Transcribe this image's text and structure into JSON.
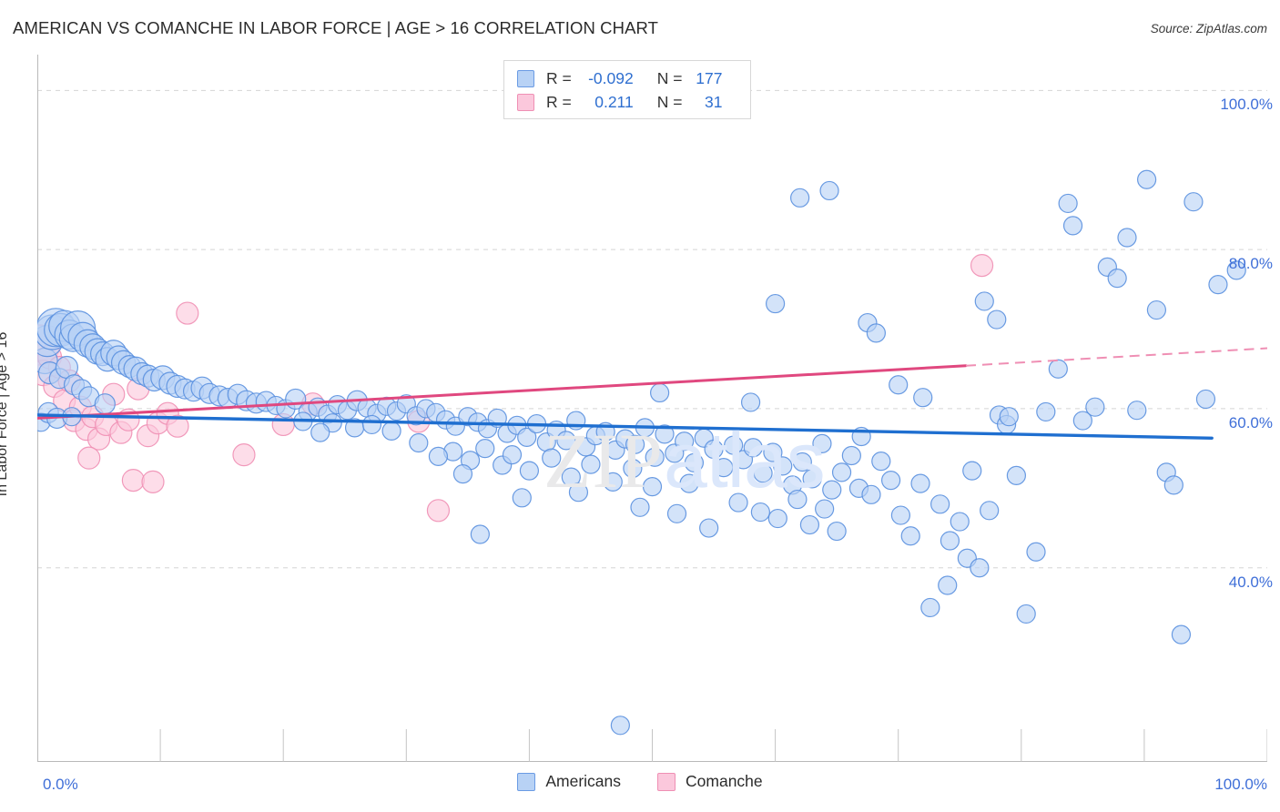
{
  "header": {
    "title": "AMERICAN VS COMANCHE IN LABOR FORCE | AGE > 16 CORRELATION CHART",
    "source": "Source: ZipAtlas.com"
  },
  "watermark": {
    "part1": "ZIP",
    "part2": "atlas"
  },
  "stats": {
    "rows": [
      {
        "series": "Americans",
        "color": "#b8d2f5",
        "r_label": "R =",
        "r_value": "-0.092",
        "n_label": "N =",
        "n_value": "177"
      },
      {
        "series": "Comanche",
        "color": "#fbc8dc",
        "r_label": "R =",
        "r_value": "0.211",
        "n_label": "N =",
        "n_value": "31"
      }
    ]
  },
  "legend": {
    "items": [
      {
        "label": "Americans",
        "color": "#b8d2f5",
        "border": "#6a9be4"
      },
      {
        "label": "Comanche",
        "color": "#fbc8dc",
        "border": "#ef8fb4"
      }
    ]
  },
  "chart_data": {
    "type": "scatter",
    "title": "AMERICAN VS COMANCHE IN LABOR FORCE | AGE > 16 CORRELATION CHART",
    "xlabel": "",
    "ylabel": "In Labor Force | Age > 16",
    "xlim": [
      0,
      100
    ],
    "ylim": [
      15.6,
      104.5
    ],
    "grid": true,
    "x_ticks": [
      0,
      10,
      20,
      30,
      40,
      50,
      60,
      70,
      80,
      90,
      100
    ],
    "x_tick_labels": [
      "0.0%",
      "100.0%"
    ],
    "y_ticks": [
      40,
      60,
      80,
      100
    ],
    "y_tick_labels": [
      "40.0%",
      "60.0%",
      "80.0%",
      "100.0%"
    ],
    "legend_position": "bottom-center",
    "series": [
      {
        "name": "Americans",
        "color": "#b8d2f5",
        "border": "#5a90df",
        "r": -0.092,
        "n": 177,
        "trend": {
          "x0": 0,
          "y0": 59.2,
          "x1": 95.5,
          "y1": 56.3,
          "color": "#1f6fd0",
          "style": "solid"
        },
        "points": [
          [
            0.3,
            58.3,
            10
          ],
          [
            0.6,
            66.0,
            14
          ],
          [
            0.8,
            68.5,
            17
          ],
          [
            1.2,
            69.6,
            19
          ],
          [
            1.5,
            70.2,
            21
          ],
          [
            1.9,
            69.9,
            18
          ],
          [
            2.2,
            70.4,
            17
          ],
          [
            2.6,
            69.3,
            16
          ],
          [
            2.9,
            68.9,
            15
          ],
          [
            3.3,
            70.1,
            19
          ],
          [
            3.7,
            69.0,
            16
          ],
          [
            4.1,
            68.2,
            15
          ],
          [
            4.5,
            67.8,
            14
          ],
          [
            4.9,
            67.2,
            14
          ],
          [
            5.3,
            66.9,
            13
          ],
          [
            5.7,
            66.2,
            13
          ],
          [
            6.2,
            67.0,
            14
          ],
          [
            6.6,
            66.4,
            13
          ],
          [
            7.0,
            65.8,
            13
          ],
          [
            7.5,
            65.3,
            12
          ],
          [
            8.0,
            65.0,
            13
          ],
          [
            8.5,
            64.4,
            12
          ],
          [
            9.0,
            64.1,
            12
          ],
          [
            9.5,
            63.6,
            12
          ],
          [
            10.2,
            63.9,
            13
          ],
          [
            10.8,
            63.2,
            12
          ],
          [
            11.4,
            62.8,
            12
          ],
          [
            12.0,
            62.5,
            11
          ],
          [
            12.7,
            62.2,
            11
          ],
          [
            13.4,
            62.6,
            12
          ],
          [
            14.0,
            61.9,
            11
          ],
          [
            14.8,
            61.6,
            11
          ],
          [
            15.5,
            61.3,
            11
          ],
          [
            16.3,
            61.8,
            11
          ],
          [
            17.0,
            61.0,
            11
          ],
          [
            17.8,
            60.7,
            11
          ],
          [
            18.6,
            60.9,
            11
          ],
          [
            19.4,
            60.4,
            10
          ],
          [
            20.2,
            60.0,
            10
          ],
          [
            21.0,
            61.2,
            11
          ],
          [
            1.0,
            64.5,
            12
          ],
          [
            1.8,
            63.8,
            11
          ],
          [
            2.4,
            65.2,
            12
          ],
          [
            3.0,
            63.0,
            11
          ],
          [
            3.6,
            62.4,
            11
          ],
          [
            0.9,
            59.5,
            11
          ],
          [
            1.6,
            58.8,
            11
          ],
          [
            2.8,
            59.0,
            10
          ],
          [
            4.2,
            61.5,
            11
          ],
          [
            5.5,
            60.6,
            11
          ],
          [
            22.0,
            59.6,
            10
          ],
          [
            22.8,
            60.2,
            10
          ],
          [
            23.6,
            59.3,
            10
          ],
          [
            24.4,
            60.5,
            10
          ],
          [
            25.2,
            59.8,
            10
          ],
          [
            26.0,
            61.0,
            11
          ],
          [
            26.8,
            60.1,
            10
          ],
          [
            27.6,
            59.4,
            10
          ],
          [
            28.4,
            60.3,
            10
          ],
          [
            29.2,
            59.7,
            10
          ],
          [
            30.0,
            60.6,
            10
          ],
          [
            30.8,
            59.1,
            10
          ],
          [
            31.6,
            60.0,
            10
          ],
          [
            32.4,
            59.5,
            10
          ],
          [
            33.2,
            58.6,
            10
          ],
          [
            34.0,
            57.8,
            10
          ],
          [
            24.0,
            58.2,
            10
          ],
          [
            25.8,
            57.6,
            10
          ],
          [
            27.2,
            58.0,
            10
          ],
          [
            28.8,
            57.2,
            10
          ],
          [
            21.6,
            58.4,
            10
          ],
          [
            23.0,
            57.0,
            10
          ],
          [
            35.0,
            59.0,
            10
          ],
          [
            35.8,
            58.3,
            10
          ],
          [
            36.6,
            57.5,
            10
          ],
          [
            37.4,
            58.8,
            10
          ],
          [
            38.2,
            56.9,
            10
          ],
          [
            39.0,
            57.9,
            10
          ],
          [
            39.8,
            56.4,
            10
          ],
          [
            40.6,
            58.1,
            10
          ],
          [
            41.4,
            55.8,
            10
          ],
          [
            42.2,
            57.3,
            10
          ],
          [
            43.0,
            56.0,
            10
          ],
          [
            43.8,
            58.5,
            10
          ],
          [
            44.6,
            55.2,
            10
          ],
          [
            45.4,
            56.6,
            10
          ],
          [
            46.2,
            57.1,
            10
          ],
          [
            47.0,
            54.8,
            10
          ],
          [
            47.8,
            56.2,
            10
          ],
          [
            48.6,
            55.5,
            10
          ],
          [
            49.4,
            57.6,
            10
          ],
          [
            50.2,
            53.9,
            10
          ],
          [
            51.0,
            56.8,
            10
          ],
          [
            51.8,
            54.4,
            10
          ],
          [
            52.6,
            55.9,
            10
          ],
          [
            53.4,
            53.2,
            10
          ],
          [
            54.2,
            56.3,
            10
          ],
          [
            55.0,
            54.9,
            10
          ],
          [
            55.8,
            52.6,
            10
          ],
          [
            56.6,
            55.4,
            10
          ],
          [
            33.8,
            54.6,
            10
          ],
          [
            35.2,
            53.5,
            10
          ],
          [
            36.4,
            55.0,
            10
          ],
          [
            37.8,
            52.9,
            10
          ],
          [
            31.0,
            55.7,
            10
          ],
          [
            32.6,
            54.0,
            10
          ],
          [
            34.6,
            51.8,
            10
          ],
          [
            38.6,
            54.2,
            10
          ],
          [
            40.0,
            52.2,
            10
          ],
          [
            41.8,
            53.8,
            10
          ],
          [
            43.4,
            51.4,
            10
          ],
          [
            45.0,
            53.0,
            10
          ],
          [
            46.8,
            50.8,
            10
          ],
          [
            48.4,
            52.5,
            10
          ],
          [
            50.0,
            50.2,
            10
          ],
          [
            44.0,
            49.5,
            10
          ],
          [
            39.4,
            48.8,
            10
          ],
          [
            49.0,
            47.6,
            10
          ],
          [
            53.0,
            50.6,
            10
          ],
          [
            36.0,
            44.2,
            10
          ],
          [
            57.4,
            53.6,
            10
          ],
          [
            58.2,
            55.1,
            10
          ],
          [
            59.0,
            51.9,
            10
          ],
          [
            59.8,
            54.5,
            10
          ],
          [
            60.6,
            52.8,
            10
          ],
          [
            61.4,
            50.4,
            10
          ],
          [
            62.2,
            53.3,
            10
          ],
          [
            63.0,
            51.2,
            10
          ],
          [
            63.8,
            55.6,
            10
          ],
          [
            64.6,
            49.8,
            10
          ],
          [
            65.4,
            52.0,
            10
          ],
          [
            66.2,
            54.1,
            10
          ],
          [
            57.0,
            48.2,
            10
          ],
          [
            58.8,
            47.0,
            10
          ],
          [
            60.2,
            46.2,
            10
          ],
          [
            61.8,
            48.6,
            10
          ],
          [
            62.8,
            45.4,
            10
          ],
          [
            64.0,
            47.4,
            10
          ],
          [
            65.0,
            44.6,
            10
          ],
          [
            66.8,
            50.0,
            10
          ],
          [
            52.0,
            46.8,
            10
          ],
          [
            54.6,
            45.0,
            10
          ],
          [
            50.6,
            62.0,
            10
          ],
          [
            58.0,
            60.8,
            10
          ],
          [
            60.0,
            73.2,
            10
          ],
          [
            62.0,
            86.5,
            10
          ],
          [
            64.4,
            87.4,
            10
          ],
          [
            67.0,
            56.5,
            10
          ],
          [
            67.8,
            49.2,
            10
          ],
          [
            68.6,
            53.4,
            10
          ],
          [
            69.4,
            51.0,
            10
          ],
          [
            70.2,
            46.6,
            10
          ],
          [
            71.0,
            44.0,
            10
          ],
          [
            71.8,
            50.6,
            10
          ],
          [
            72.6,
            35.0,
            10
          ],
          [
            73.4,
            48.0,
            10
          ],
          [
            74.2,
            43.4,
            10
          ],
          [
            75.0,
            45.8,
            10
          ],
          [
            76.0,
            52.2,
            10
          ],
          [
            67.5,
            70.8,
            10
          ],
          [
            68.2,
            69.5,
            10
          ],
          [
            70.0,
            63.0,
            10
          ],
          [
            72.0,
            61.4,
            10
          ],
          [
            74.0,
            37.8,
            10
          ],
          [
            75.6,
            41.2,
            10
          ],
          [
            76.6,
            40.0,
            10
          ],
          [
            77.4,
            47.2,
            10
          ],
          [
            78.2,
            59.2,
            10
          ],
          [
            78.8,
            58.0,
            10
          ],
          [
            79.6,
            51.6,
            10
          ],
          [
            80.4,
            34.2,
            10
          ],
          [
            81.2,
            42.0,
            10
          ],
          [
            77.0,
            73.5,
            10
          ],
          [
            78.0,
            71.2,
            10
          ],
          [
            79.0,
            59.0,
            10
          ],
          [
            82.0,
            59.6,
            10
          ],
          [
            83.0,
            65.0,
            10
          ],
          [
            83.8,
            85.8,
            10
          ],
          [
            84.2,
            83.0,
            10
          ],
          [
            85.0,
            58.5,
            10
          ],
          [
            86.0,
            60.2,
            10
          ],
          [
            87.0,
            77.8,
            10
          ],
          [
            87.8,
            76.4,
            10
          ],
          [
            88.6,
            81.5,
            10
          ],
          [
            89.4,
            59.8,
            10
          ],
          [
            90.2,
            88.8,
            10
          ],
          [
            91.0,
            72.4,
            10
          ],
          [
            91.8,
            52.0,
            10
          ],
          [
            92.4,
            50.4,
            10
          ],
          [
            93.0,
            31.6,
            10
          ],
          [
            94.0,
            86.0,
            10
          ],
          [
            95.0,
            61.2,
            10
          ],
          [
            96.0,
            75.6,
            10
          ],
          [
            97.5,
            77.4,
            10
          ],
          [
            47.4,
            20.2,
            10
          ]
        ]
      },
      {
        "name": "Comanche",
        "color": "#fbc8dc",
        "border": "#ef8fb4",
        "r": 0.211,
        "n": 31,
        "trend": {
          "x0": 0,
          "y0": 58.8,
          "x1": 75.5,
          "y1": 65.4,
          "color": "#e0487f",
          "style": "solid"
        },
        "trend_dashed": {
          "x0": 75.5,
          "y0": 65.4,
          "x1": 100.0,
          "y1": 67.6,
          "color": "#ef8fb4",
          "style": "dashed"
        },
        "points": [
          [
            0.2,
            68.0,
            22
          ],
          [
            0.5,
            64.5,
            14
          ],
          [
            1.0,
            66.5,
            13
          ],
          [
            1.4,
            62.8,
            12
          ],
          [
            1.8,
            65.2,
            12
          ],
          [
            2.2,
            61.0,
            12
          ],
          [
            2.6,
            63.5,
            12
          ],
          [
            3.0,
            58.5,
            12
          ],
          [
            3.5,
            60.2,
            12
          ],
          [
            4.0,
            57.4,
            12
          ],
          [
            4.5,
            59.0,
            12
          ],
          [
            5.0,
            56.2,
            12
          ],
          [
            5.6,
            58.0,
            12
          ],
          [
            6.2,
            61.8,
            12
          ],
          [
            6.8,
            57.0,
            12
          ],
          [
            7.4,
            58.6,
            12
          ],
          [
            8.2,
            62.5,
            12
          ],
          [
            9.0,
            56.6,
            12
          ],
          [
            9.8,
            58.2,
            12
          ],
          [
            4.2,
            53.8,
            12
          ],
          [
            7.8,
            51.0,
            12
          ],
          [
            9.4,
            50.8,
            12
          ],
          [
            10.6,
            59.4,
            12
          ],
          [
            11.4,
            57.8,
            12
          ],
          [
            12.2,
            72.0,
            12
          ],
          [
            16.8,
            54.2,
            12
          ],
          [
            20.0,
            58.0,
            12
          ],
          [
            22.4,
            60.6,
            12
          ],
          [
            31.0,
            58.4,
            12
          ],
          [
            32.6,
            47.2,
            12
          ],
          [
            76.8,
            78.0,
            12
          ]
        ]
      }
    ]
  }
}
